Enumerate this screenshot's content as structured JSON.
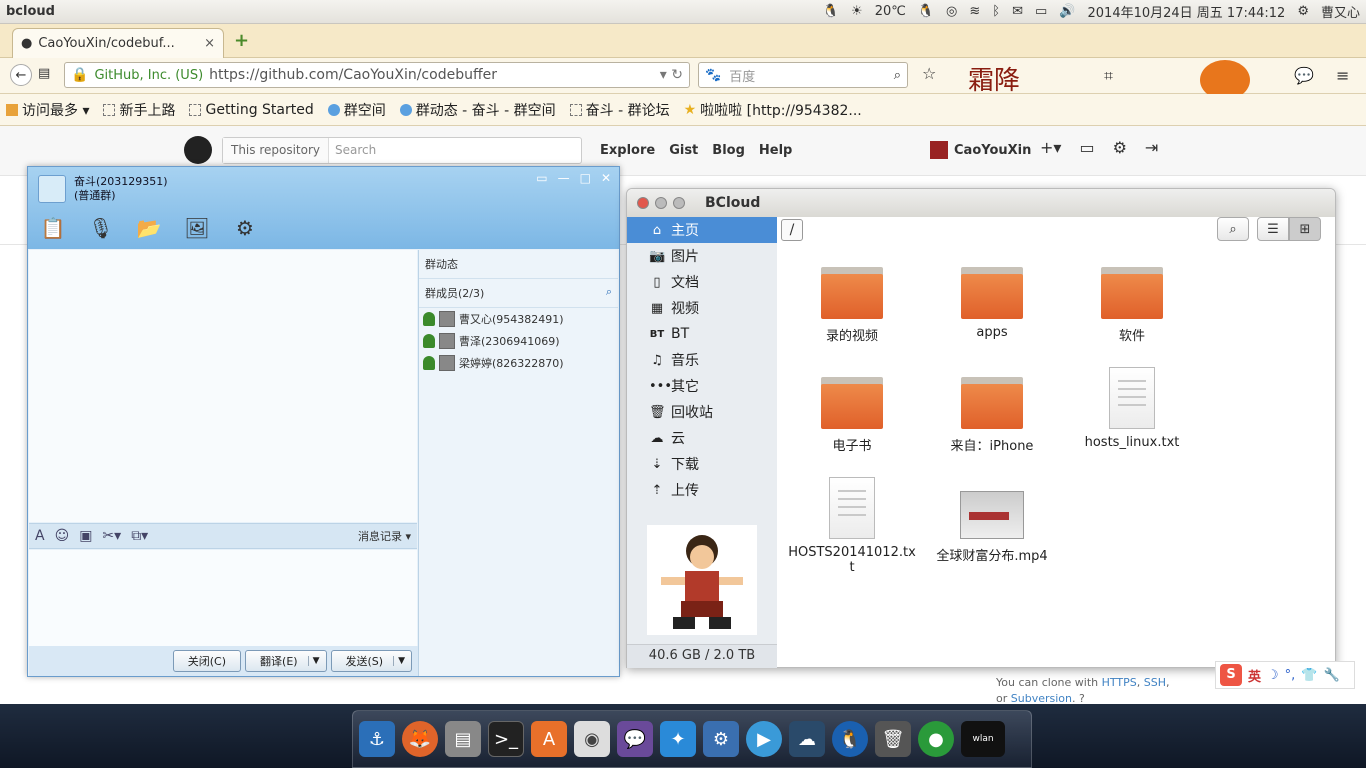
{
  "top_panel": {
    "app_name": "bcloud",
    "temperature": "20℃",
    "datetime": "2014年10月24日 周五 17:44:12",
    "username": "曹又心"
  },
  "browser": {
    "tab_title": "CaoYouXin/codebuf...",
    "tab_close": "×",
    "new_tab": "+",
    "site_identity": "GitHub, Inc. (US)",
    "url": "https://github.com/CaoYouXin/codebuffer",
    "search_placeholder": "百度",
    "bookmarks": [
      {
        "label": "访问最多 ▾"
      },
      {
        "label": "新手上路"
      },
      {
        "label": "Getting Started"
      },
      {
        "label": "群空间"
      },
      {
        "label": "群动态 - 奋斗 - 群空间"
      },
      {
        "label": "奋斗 - 群论坛"
      },
      {
        "label": "啦啦啦 [http://954382..."
      }
    ]
  },
  "github": {
    "search_scope": "This repository",
    "search_placeholder": "Search",
    "nav": [
      "Explore",
      "Gist",
      "Blog",
      "Help"
    ],
    "username": "CaoYouXin",
    "clone_text": "You can clone with",
    "clone_https": "HTTPS",
    "clone_ssh": "SSH",
    "clone_or": "or",
    "clone_svn": "Subversion"
  },
  "qq": {
    "group_name": "奋斗(203129351)",
    "group_type": "(普通群)",
    "side_title": "群动态",
    "members_title": "群成员(2/3)",
    "members": [
      {
        "name": "曹又心(954382491)"
      },
      {
        "name": "曹泽(2306941069)"
      },
      {
        "name": "梁婷婷(826322870)"
      }
    ],
    "history_label": "消息记录 ▾",
    "close_label": "关闭(C)",
    "translate_label": "翻译(E)",
    "send_label": "发送(S)"
  },
  "bcloud": {
    "title": "BCloud",
    "path": "/",
    "nav": [
      {
        "label": "主页",
        "icon": "home-icon"
      },
      {
        "label": "图片",
        "icon": "camera-icon"
      },
      {
        "label": "文档",
        "icon": "document-icon"
      },
      {
        "label": "视频",
        "icon": "film-icon"
      },
      {
        "label": "BT",
        "icon": "bt-icon"
      },
      {
        "label": "音乐",
        "icon": "music-icon"
      },
      {
        "label": "其它",
        "icon": "more-icon"
      },
      {
        "label": "回收站",
        "icon": "trash-icon"
      },
      {
        "label": "云",
        "icon": "cloud-icon"
      },
      {
        "label": "下载",
        "icon": "download-icon"
      },
      {
        "label": "上传",
        "icon": "upload-icon"
      }
    ],
    "quota": "40.6 GB / 2.0 TB",
    "files": [
      {
        "name": "录的视频",
        "kind": "folder"
      },
      {
        "name": "apps",
        "kind": "folder"
      },
      {
        "name": "软件",
        "kind": "folder"
      },
      {
        "name": "电子书",
        "kind": "folder"
      },
      {
        "name": "来自：iPhone",
        "kind": "folder"
      },
      {
        "name": "hosts_linux.txt",
        "kind": "text"
      },
      {
        "name": "HOSTS20141012.txt",
        "kind": "text"
      },
      {
        "name": "全球财富分布.mp4",
        "kind": "video"
      }
    ]
  },
  "ime": {
    "mode": "英"
  },
  "colors": {
    "accent": "#4a8dd6",
    "folder": "#e8763a",
    "qq_header": "#7cb7e5"
  }
}
